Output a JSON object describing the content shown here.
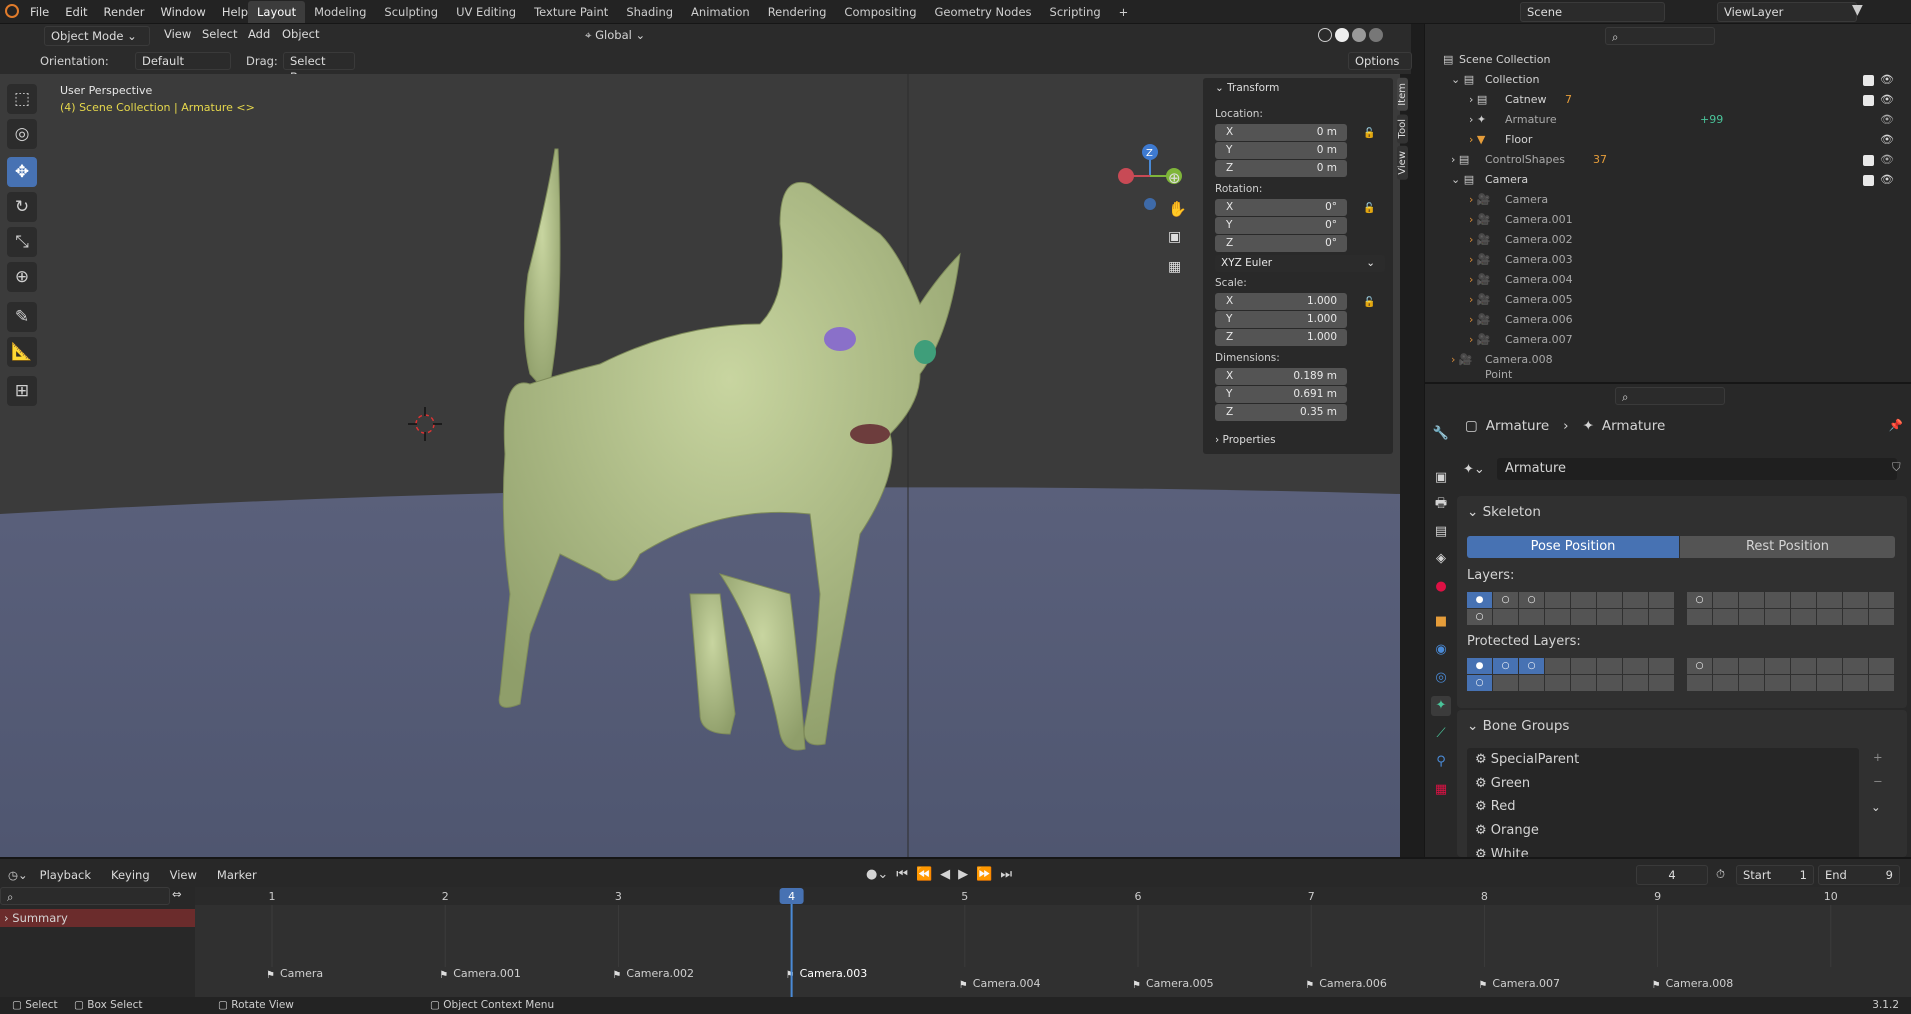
{
  "topbar": {
    "menus": [
      "File",
      "Edit",
      "Render",
      "Window",
      "Help"
    ],
    "workspaces": [
      "Layout",
      "Modeling",
      "Sculpting",
      "UV Editing",
      "Texture Paint",
      "Shading",
      "Animation",
      "Rendering",
      "Compositing",
      "Geometry Nodes",
      "Scripting"
    ],
    "active_workspace": "Layout",
    "scene": "Scene",
    "view_layer": "ViewLayer"
  },
  "viewport_header": {
    "mode": "Object Mode",
    "menus": [
      "View",
      "Select",
      "Add",
      "Object"
    ],
    "transform_orientation": "Global",
    "orientation_label": "Orientation:",
    "orientation_value": "Default",
    "drag_label": "Drag:",
    "drag_value": "Select Box",
    "options": "Options"
  },
  "viewport": {
    "title": "User Perspective",
    "subtitle": "(4) Scene Collection | Armature <>",
    "gizmo_axis_label": "Z"
  },
  "npanel": {
    "section": "Transform",
    "location_label": "Location:",
    "location": [
      {
        "axis": "X",
        "value": "0 m"
      },
      {
        "axis": "Y",
        "value": "0 m"
      },
      {
        "axis": "Z",
        "value": "0 m"
      }
    ],
    "rotation_label": "Rotation:",
    "rotation": [
      {
        "axis": "X",
        "value": "0°"
      },
      {
        "axis": "Y",
        "value": "0°"
      },
      {
        "axis": "Z",
        "value": "0°"
      }
    ],
    "rotation_mode": "XYZ Euler",
    "scale_label": "Scale:",
    "scale": [
      {
        "axis": "X",
        "value": "1.000"
      },
      {
        "axis": "Y",
        "value": "1.000"
      },
      {
        "axis": "Z",
        "value": "1.000"
      }
    ],
    "dimensions_label": "Dimensions:",
    "dimensions": [
      {
        "axis": "X",
        "value": "0.189 m"
      },
      {
        "axis": "Y",
        "value": "0.691 m"
      },
      {
        "axis": "Z",
        "value": "0.35 m"
      }
    ],
    "properties": "Properties",
    "tabs": [
      "Item",
      "Tool",
      "View"
    ]
  },
  "outliner": {
    "root": "Scene Collection",
    "rows": [
      {
        "label": "Collection",
        "extra": ""
      },
      {
        "label": "Catnew",
        "extra": "7"
      },
      {
        "label": "Armature",
        "extra": "+99"
      },
      {
        "label": "Floor",
        "extra": ""
      },
      {
        "label": "ControlShapes",
        "extra": "37"
      },
      {
        "label": "Camera",
        "extra": ""
      },
      {
        "label": "Camera",
        "extra": ""
      },
      {
        "label": "Camera.001",
        "extra": ""
      },
      {
        "label": "Camera.002",
        "extra": ""
      },
      {
        "label": "Camera.003",
        "extra": ""
      },
      {
        "label": "Camera.004",
        "extra": ""
      },
      {
        "label": "Camera.005",
        "extra": ""
      },
      {
        "label": "Camera.006",
        "extra": ""
      },
      {
        "label": "Camera.007",
        "extra": ""
      },
      {
        "label": "Camera.008",
        "extra": ""
      },
      {
        "label": "Point",
        "extra": ""
      }
    ]
  },
  "properties": {
    "breadcrumb_object": "Armature",
    "breadcrumb_data": "Armature",
    "data_name": "Armature",
    "skeleton_title": "Skeleton",
    "pose_position": "Pose Position",
    "rest_position": "Rest Position",
    "layers_label": "Layers:",
    "protected_layers_label": "Protected Layers:",
    "bone_groups_title": "Bone Groups",
    "bone_groups": [
      "SpecialParent",
      "Green",
      "Red",
      "Orange",
      "White"
    ]
  },
  "timeline": {
    "menus": [
      "Playback",
      "Keying",
      "View",
      "Marker"
    ],
    "current_frame": "4",
    "start_label": "Start",
    "start": "1",
    "end_label": "End",
    "end": "9",
    "ruler": [
      "1",
      "2",
      "3",
      "4",
      "5",
      "6",
      "7",
      "8",
      "9",
      "10"
    ],
    "summary": "Summary",
    "markers": [
      "Camera",
      "Camera.001",
      "Camera.002",
      "Camera.003",
      "Camera.004",
      "Camera.005",
      "Camera.006",
      "Camera.007",
      "Camera.008"
    ]
  },
  "status": {
    "select": "Select",
    "box_select": "Box Select",
    "rotate_view": "Rotate View",
    "context_menu": "Object Context Menu",
    "version": "3.1.2"
  }
}
